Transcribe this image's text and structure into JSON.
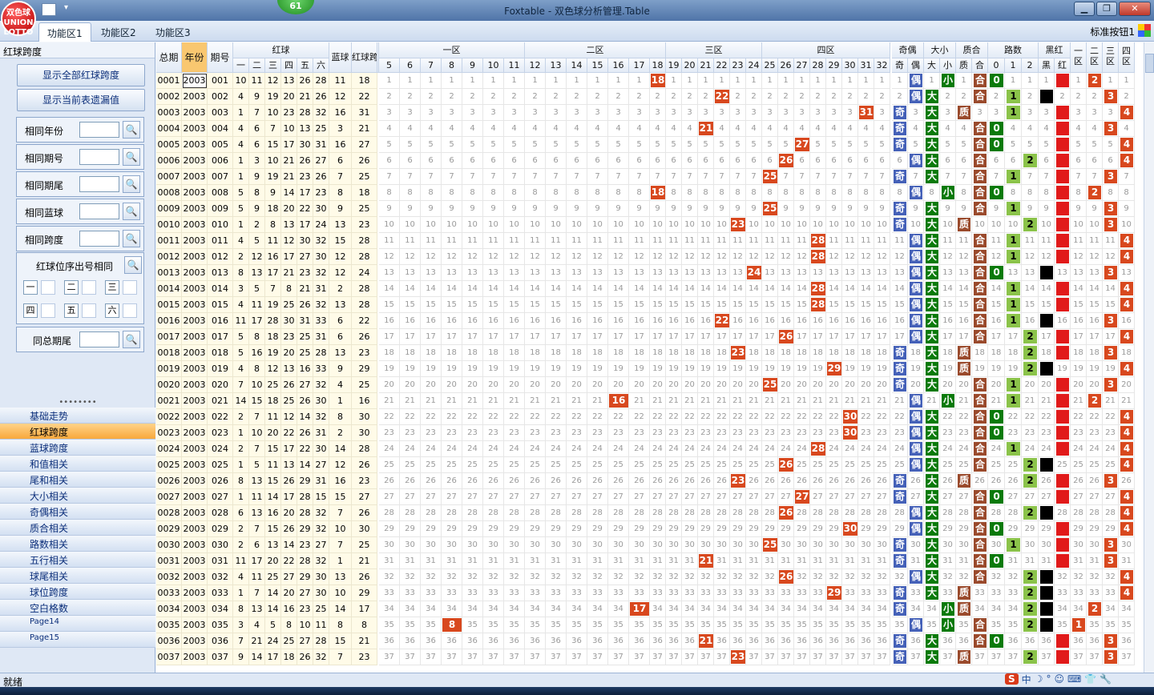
{
  "window": {
    "title": "Foxtable - 双色球分析管理.Table",
    "logo_text": "双色球 UNION LOTTO",
    "counter": "61",
    "controls": [
      "▁",
      "❐",
      "✕"
    ]
  },
  "tabs": [
    "功能区1",
    "功能区2",
    "功能区3"
  ],
  "active_tab": 0,
  "toolbar_right": "标准按钮1",
  "left_panel": {
    "header": "红球跨度",
    "buttons": [
      "显示全部红球跨度",
      "显示当前表遗漏值"
    ],
    "filters": [
      "相同年份",
      "相同期号",
      "相同期尾",
      "相同蓝球",
      "相同跨度"
    ],
    "position_group": {
      "label": "红球位序出号相同",
      "positions": [
        "一",
        "二",
        "三",
        "四",
        "五",
        "六"
      ]
    },
    "tail_filter": "同总期尾",
    "splitter": "••••••••",
    "nav_items": [
      "基础走势",
      "红球跨度",
      "蓝球跨度",
      "和值相关",
      "尾和相关",
      "大小相关",
      "奇偶相关",
      "质合相关",
      "路数相关",
      "五行相关",
      "球尾相关",
      "球位跨度",
      "空白格数",
      "Page14",
      "Page15"
    ],
    "active_nav": 1
  },
  "grid": {
    "key_headers": [
      "总期",
      "年份",
      "期号"
    ],
    "red_header": "红球",
    "red_subheaders": [
      "一",
      "二",
      "三",
      "四",
      "五",
      "六"
    ],
    "blue_header": "蓝球",
    "span_header": "红球跨度",
    "zone_headers": [
      "一区",
      "二区",
      "三区",
      "四区"
    ],
    "span_values": [
      "5",
      "6",
      "7",
      "8",
      "9",
      "10",
      "11",
      "12",
      "13",
      "14",
      "15",
      "16",
      "17",
      "18",
      "19",
      "20",
      "21",
      "22",
      "23",
      "24",
      "25",
      "26",
      "27",
      "28",
      "29",
      "30",
      "31",
      "32"
    ],
    "parity_header": "奇偶",
    "parity_sub": [
      "奇",
      "偶"
    ],
    "size_header": "大小",
    "size_sub": [
      "大",
      "小"
    ],
    "prime_header": "质合",
    "prime_sub": [
      "质",
      "合"
    ],
    "road_header": "路数",
    "road_sub": [
      "0",
      "1",
      "2"
    ],
    "color_header": "黑红",
    "color_sub": [
      "黑",
      "红"
    ],
    "area_headers": [
      "一区",
      "二区",
      "三区",
      "四区"
    ],
    "rows": [
      {
        "no": "0001",
        "year": "2003",
        "issue": "001",
        "red": [
          "10",
          "11",
          "12",
          "13",
          "26",
          "28"
        ],
        "blue": "11",
        "span": "18",
        "parity": "偶",
        "size": "小",
        "prime": "合",
        "road": "0",
        "color": "红",
        "area": "二"
      },
      {
        "no": "0002",
        "year": "2003",
        "issue": "002",
        "red": [
          "4",
          "9",
          "19",
          "20",
          "21",
          "26"
        ],
        "blue": "12",
        "span": "22",
        "parity": "偶",
        "size": "大",
        "prime": "合",
        "road": "1",
        "color": "黑",
        "area": "三"
      },
      {
        "no": "0003",
        "year": "2003",
        "issue": "003",
        "red": [
          "1",
          "7",
          "10",
          "23",
          "28",
          "32"
        ],
        "blue": "16",
        "span": "31",
        "parity": "奇",
        "size": "大",
        "prime": "质",
        "road": "1",
        "color": "红",
        "area": "四"
      },
      {
        "no": "0004",
        "year": "2003",
        "issue": "004",
        "red": [
          "4",
          "6",
          "7",
          "10",
          "13",
          "25"
        ],
        "blue": "3",
        "span": "21",
        "parity": "奇",
        "size": "大",
        "prime": "合",
        "road": "0",
        "color": "红",
        "area": "三"
      },
      {
        "no": "0005",
        "year": "2003",
        "issue": "005",
        "red": [
          "4",
          "6",
          "15",
          "17",
          "30",
          "31"
        ],
        "blue": "16",
        "span": "27",
        "parity": "奇",
        "size": "大",
        "prime": "合",
        "road": "0",
        "color": "红",
        "area": "四"
      },
      {
        "no": "0006",
        "year": "2003",
        "issue": "006",
        "red": [
          "1",
          "3",
          "10",
          "21",
          "26",
          "27"
        ],
        "blue": "6",
        "span": "26",
        "parity": "偶",
        "size": "大",
        "prime": "合",
        "road": "2",
        "color": "红",
        "area": "四"
      },
      {
        "no": "0007",
        "year": "2003",
        "issue": "007",
        "red": [
          "1",
          "9",
          "19",
          "21",
          "23",
          "26"
        ],
        "blue": "7",
        "span": "25",
        "parity": "奇",
        "size": "大",
        "prime": "合",
        "road": "1",
        "color": "红",
        "area": "三"
      },
      {
        "no": "0008",
        "year": "2003",
        "issue": "008",
        "red": [
          "5",
          "8",
          "9",
          "14",
          "17",
          "23"
        ],
        "blue": "8",
        "span": "18",
        "parity": "偶",
        "size": "小",
        "prime": "合",
        "road": "0",
        "color": "红",
        "area": "二"
      },
      {
        "no": "0009",
        "year": "2003",
        "issue": "009",
        "red": [
          "5",
          "9",
          "18",
          "20",
          "22",
          "30"
        ],
        "blue": "9",
        "span": "25",
        "parity": "奇",
        "size": "大",
        "prime": "合",
        "road": "1",
        "color": "红",
        "area": "三"
      },
      {
        "no": "0010",
        "year": "2003",
        "issue": "010",
        "red": [
          "1",
          "2",
          "8",
          "13",
          "17",
          "24"
        ],
        "blue": "13",
        "span": "23",
        "parity": "奇",
        "size": "大",
        "prime": "质",
        "road": "2",
        "color": "红",
        "area": "三"
      },
      {
        "no": "0011",
        "year": "2003",
        "issue": "011",
        "red": [
          "4",
          "5",
          "11",
          "12",
          "30",
          "32"
        ],
        "blue": "15",
        "span": "28",
        "parity": "偶",
        "size": "大",
        "prime": "合",
        "road": "1",
        "color": "红",
        "area": "四"
      },
      {
        "no": "0012",
        "year": "2003",
        "issue": "012",
        "red": [
          "2",
          "12",
          "16",
          "17",
          "27",
          "30"
        ],
        "blue": "12",
        "span": "28",
        "parity": "偶",
        "size": "大",
        "prime": "合",
        "road": "1",
        "color": "红",
        "area": "四"
      },
      {
        "no": "0013",
        "year": "2003",
        "issue": "013",
        "red": [
          "8",
          "13",
          "17",
          "21",
          "23",
          "32"
        ],
        "blue": "12",
        "span": "24",
        "parity": "偶",
        "size": "大",
        "prime": "合",
        "road": "0",
        "color": "黑",
        "area": "三"
      },
      {
        "no": "0014",
        "year": "2003",
        "issue": "014",
        "red": [
          "3",
          "5",
          "7",
          "8",
          "21",
          "31"
        ],
        "blue": "2",
        "span": "28",
        "parity": "偶",
        "size": "大",
        "prime": "合",
        "road": "1",
        "color": "红",
        "area": "四"
      },
      {
        "no": "0015",
        "year": "2003",
        "issue": "015",
        "red": [
          "4",
          "11",
          "19",
          "25",
          "26",
          "32"
        ],
        "blue": "13",
        "span": "28",
        "parity": "偶",
        "size": "大",
        "prime": "合",
        "road": "1",
        "color": "红",
        "area": "四"
      },
      {
        "no": "0016",
        "year": "2003",
        "issue": "016",
        "red": [
          "11",
          "17",
          "28",
          "30",
          "31",
          "33"
        ],
        "blue": "6",
        "span": "22",
        "parity": "偶",
        "size": "大",
        "prime": "合",
        "road": "1",
        "color": "黑",
        "area": "三"
      },
      {
        "no": "0017",
        "year": "2003",
        "issue": "017",
        "red": [
          "5",
          "8",
          "18",
          "23",
          "25",
          "31"
        ],
        "blue": "6",
        "span": "26",
        "parity": "偶",
        "size": "大",
        "prime": "合",
        "road": "2",
        "color": "红",
        "area": "四"
      },
      {
        "no": "0018",
        "year": "2003",
        "issue": "018",
        "red": [
          "5",
          "16",
          "19",
          "20",
          "25",
          "28"
        ],
        "blue": "13",
        "span": "23",
        "parity": "奇",
        "size": "大",
        "prime": "质",
        "road": "2",
        "color": "红",
        "area": "三"
      },
      {
        "no": "0019",
        "year": "2003",
        "issue": "019",
        "red": [
          "4",
          "8",
          "12",
          "13",
          "16",
          "33"
        ],
        "blue": "9",
        "span": "29",
        "parity": "奇",
        "size": "大",
        "prime": "质",
        "road": "2",
        "color": "黑",
        "area": "四"
      },
      {
        "no": "0020",
        "year": "2003",
        "issue": "020",
        "red": [
          "7",
          "10",
          "25",
          "26",
          "27",
          "32"
        ],
        "blue": "4",
        "span": "25",
        "parity": "奇",
        "size": "大",
        "prime": "合",
        "road": "1",
        "color": "红",
        "area": "三"
      },
      {
        "no": "0021",
        "year": "2003",
        "issue": "021",
        "red": [
          "14",
          "15",
          "18",
          "25",
          "26",
          "30"
        ],
        "blue": "1",
        "span": "16",
        "parity": "偶",
        "size": "小",
        "prime": "合",
        "road": "1",
        "color": "红",
        "area": "二"
      },
      {
        "no": "0022",
        "year": "2003",
        "issue": "022",
        "red": [
          "2",
          "7",
          "11",
          "12",
          "14",
          "32"
        ],
        "blue": "8",
        "span": "30",
        "parity": "偶",
        "size": "大",
        "prime": "合",
        "road": "0",
        "color": "红",
        "area": "四"
      },
      {
        "no": "0023",
        "year": "2003",
        "issue": "023",
        "red": [
          "1",
          "10",
          "20",
          "22",
          "26",
          "31"
        ],
        "blue": "2",
        "span": "30",
        "parity": "偶",
        "size": "大",
        "prime": "合",
        "road": "0",
        "color": "红",
        "area": "四"
      },
      {
        "no": "0024",
        "year": "2003",
        "issue": "024",
        "red": [
          "2",
          "7",
          "15",
          "17",
          "22",
          "30"
        ],
        "blue": "14",
        "span": "28",
        "parity": "偶",
        "size": "大",
        "prime": "合",
        "road": "1",
        "color": "红",
        "area": "四"
      },
      {
        "no": "0025",
        "year": "2003",
        "issue": "025",
        "red": [
          "1",
          "5",
          "11",
          "13",
          "14",
          "27"
        ],
        "blue": "12",
        "span": "26",
        "parity": "偶",
        "size": "大",
        "prime": "合",
        "road": "2",
        "color": "黑",
        "area": "四"
      },
      {
        "no": "0026",
        "year": "2003",
        "issue": "026",
        "red": [
          "8",
          "13",
          "15",
          "26",
          "29",
          "31"
        ],
        "blue": "16",
        "span": "23",
        "parity": "奇",
        "size": "大",
        "prime": "质",
        "road": "2",
        "color": "红",
        "area": "三"
      },
      {
        "no": "0027",
        "year": "2003",
        "issue": "027",
        "red": [
          "1",
          "11",
          "14",
          "17",
          "28",
          "15"
        ],
        "blue": "15",
        "span": "27",
        "parity": "奇",
        "size": "大",
        "prime": "合",
        "road": "0",
        "color": "红",
        "area": "四"
      },
      {
        "no": "0028",
        "year": "2003",
        "issue": "028",
        "red": [
          "6",
          "13",
          "16",
          "20",
          "28",
          "32"
        ],
        "blue": "7",
        "span": "26",
        "parity": "偶",
        "size": "大",
        "prime": "合",
        "road": "2",
        "color": "黑",
        "area": "四"
      },
      {
        "no": "0029",
        "year": "2003",
        "issue": "029",
        "red": [
          "2",
          "7",
          "15",
          "26",
          "29",
          "32"
        ],
        "blue": "10",
        "span": "30",
        "parity": "偶",
        "size": "大",
        "prime": "合",
        "road": "0",
        "color": "红",
        "area": "四"
      },
      {
        "no": "0030",
        "year": "2003",
        "issue": "030",
        "red": [
          "2",
          "6",
          "13",
          "14",
          "23",
          "27"
        ],
        "blue": "7",
        "span": "25",
        "parity": "奇",
        "size": "大",
        "prime": "合",
        "road": "1",
        "color": "红",
        "area": "三"
      },
      {
        "no": "0031",
        "year": "2003",
        "issue": "031",
        "red": [
          "11",
          "17",
          "20",
          "22",
          "28",
          "32"
        ],
        "blue": "1",
        "span": "21",
        "parity": "奇",
        "size": "大",
        "prime": "合",
        "road": "0",
        "color": "红",
        "area": "三"
      },
      {
        "no": "0032",
        "year": "2003",
        "issue": "032",
        "red": [
          "4",
          "11",
          "25",
          "27",
          "29",
          "30"
        ],
        "blue": "13",
        "span": "26",
        "parity": "偶",
        "size": "大",
        "prime": "合",
        "road": "2",
        "color": "黑",
        "area": "四"
      },
      {
        "no": "0033",
        "year": "2003",
        "issue": "033",
        "red": [
          "1",
          "7",
          "14",
          "20",
          "27",
          "30"
        ],
        "blue": "10",
        "span": "29",
        "parity": "奇",
        "size": "大",
        "prime": "质",
        "road": "2",
        "color": "黑",
        "area": "四"
      },
      {
        "no": "0034",
        "year": "2003",
        "issue": "034",
        "red": [
          "8",
          "13",
          "14",
          "16",
          "23",
          "25"
        ],
        "blue": "14",
        "span": "17",
        "parity": "奇",
        "size": "小",
        "prime": "质",
        "road": "2",
        "color": "黑",
        "area": "二"
      },
      {
        "no": "0035",
        "year": "2003",
        "issue": "035",
        "red": [
          "3",
          "4",
          "5",
          "8",
          "10",
          "11"
        ],
        "blue": "8",
        "span": "8",
        "parity": "偶",
        "size": "小",
        "prime": "合",
        "road": "2",
        "color": "黑",
        "area": "一"
      },
      {
        "no": "0036",
        "year": "2003",
        "issue": "036",
        "red": [
          "7",
          "21",
          "24",
          "25",
          "27",
          "28"
        ],
        "blue": "15",
        "span": "21",
        "parity": "奇",
        "size": "大",
        "prime": "合",
        "road": "0",
        "color": "红",
        "area": "三"
      },
      {
        "no": "0037",
        "year": "2003",
        "issue": "037",
        "red": [
          "9",
          "14",
          "17",
          "18",
          "26",
          "32"
        ],
        "blue": "7",
        "span": "23",
        "parity": "奇",
        "size": "大",
        "prime": "质",
        "road": "2",
        "color": "红",
        "area": "三"
      }
    ]
  },
  "status": "就绪",
  "ime_icons": [
    "S",
    "中",
    "☽",
    "°",
    "☺",
    "⌨",
    "👕",
    "🔧"
  ]
}
